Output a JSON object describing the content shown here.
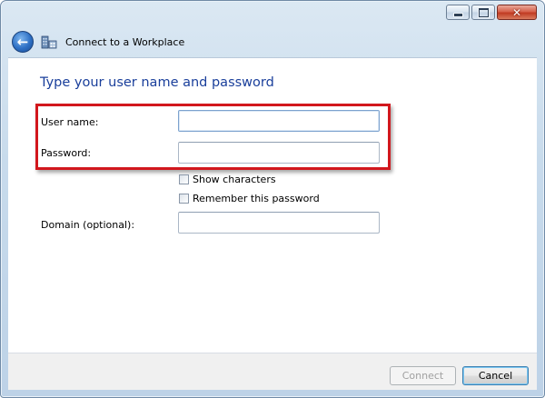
{
  "window": {
    "title": "Connect to a Workplace",
    "caption_buttons": {
      "minimize_icon": "minimize-icon",
      "maximize_icon": "maximize-icon",
      "close_glyph": "✕"
    },
    "back_glyph": "←"
  },
  "form": {
    "heading": "Type your user name and password",
    "username": {
      "label": "User name:",
      "value": ""
    },
    "password": {
      "label": "Password:",
      "value": ""
    },
    "show_characters": {
      "label": "Show characters",
      "checked": false
    },
    "remember_password": {
      "label": "Remember this password",
      "checked": false
    },
    "domain": {
      "label": "Domain (optional):",
      "value": ""
    }
  },
  "footer": {
    "connect_label": "Connect",
    "cancel_label": "Cancel"
  },
  "colors": {
    "heading": "#1a3f9b",
    "highlight_border": "#d2171d"
  }
}
